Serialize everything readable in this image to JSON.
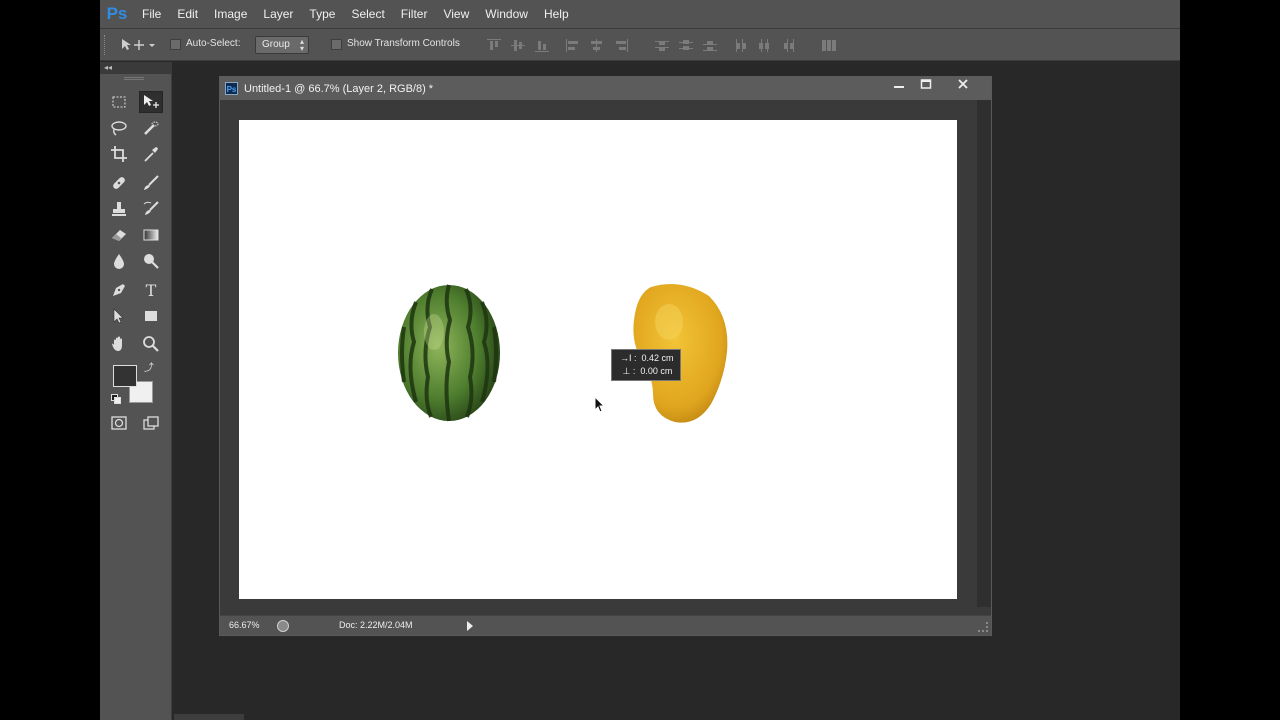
{
  "app": {
    "logo": "Ps"
  },
  "menu": [
    "File",
    "Edit",
    "Image",
    "Layer",
    "Type",
    "Select",
    "Filter",
    "View",
    "Window",
    "Help"
  ],
  "options": {
    "auto_select_label": "Auto-Select:",
    "auto_select_checked": false,
    "auto_select_target": "Group",
    "show_transform_label": "Show Transform Controls",
    "show_transform_checked": false
  },
  "toolbar": {
    "collapse_glyph": "◂◂",
    "tools": [
      {
        "name": "rectangular-marquee-tool",
        "icon": "marquee-icon"
      },
      {
        "name": "move-tool",
        "icon": "move-icon",
        "active": true
      },
      {
        "name": "lasso-tool",
        "icon": "lasso-icon"
      },
      {
        "name": "quick-selection-tool",
        "icon": "quick-selection-icon"
      },
      {
        "name": "crop-tool",
        "icon": "crop-icon"
      },
      {
        "name": "eyedropper-tool",
        "icon": "eyedropper-icon"
      },
      {
        "name": "spot-healing-tool",
        "icon": "bandage-icon"
      },
      {
        "name": "brush-tool",
        "icon": "brush-icon"
      },
      {
        "name": "clone-stamp-tool",
        "icon": "stamp-icon"
      },
      {
        "name": "history-brush-tool",
        "icon": "history-brush-icon"
      },
      {
        "name": "eraser-tool",
        "icon": "eraser-icon"
      },
      {
        "name": "gradient-tool",
        "icon": "gradient-icon"
      },
      {
        "name": "blur-tool",
        "icon": "drop-icon"
      },
      {
        "name": "dodge-tool",
        "icon": "dodge-icon"
      },
      {
        "name": "pen-tool",
        "icon": "pen-icon"
      },
      {
        "name": "type-tool",
        "icon": "type-icon",
        "glyph": "T"
      },
      {
        "name": "path-selection-tool",
        "icon": "path-selection-icon"
      },
      {
        "name": "rectangle-tool",
        "icon": "rectangle-icon"
      },
      {
        "name": "hand-tool",
        "icon": "hand-icon"
      },
      {
        "name": "zoom-tool",
        "icon": "zoom-icon"
      }
    ],
    "foreground_color": "#333333",
    "background_color": "#f0f0f0"
  },
  "document": {
    "title": "Untitled-1 @ 66.7% (Layer 2, RGB/8) *",
    "icon_text": "Ps",
    "zoom": "66.67%",
    "doc_info": "Doc: 2.22M/2.04M",
    "canvas_color": "#ffffff",
    "layers_on_canvas": [
      "watermelon",
      "mango"
    ]
  },
  "measure_tooltip": {
    "horizontal": "0.42 cm",
    "vertical": "0.00 cm"
  },
  "colors": {
    "panel": "#535353",
    "workspace": "#282828",
    "accent": "#2f8de4"
  }
}
